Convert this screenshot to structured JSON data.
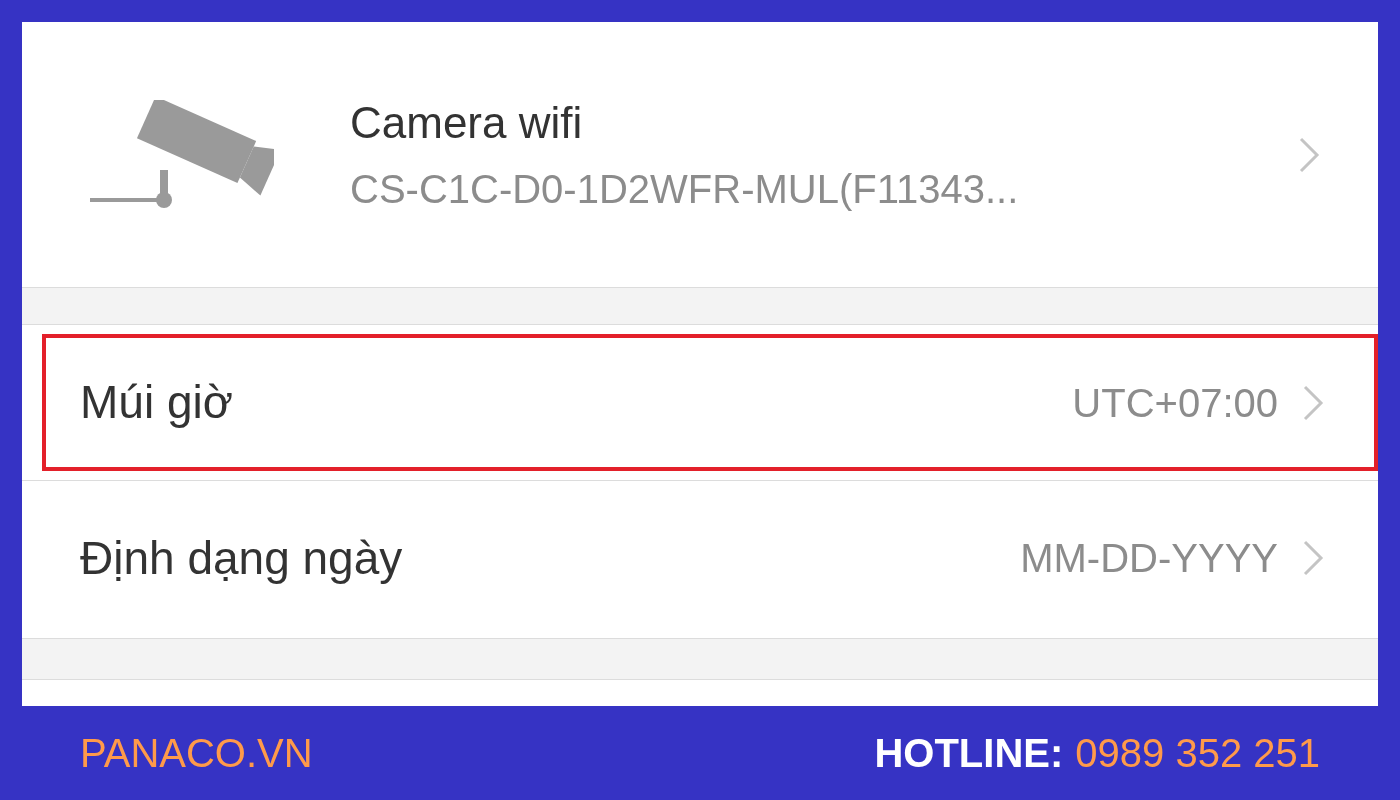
{
  "device": {
    "name": "Camera wifi",
    "model": "CS-C1C-D0-1D2WFR-MUL(F11343..."
  },
  "settings": [
    {
      "label": "Múi giờ",
      "value": "UTC+07:00",
      "highlighted": true
    },
    {
      "label": "Định dạng ngày",
      "value": "MM-DD-YYYY",
      "highlighted": false
    }
  ],
  "banner": {
    "site": "PANACO.VN",
    "hotline_label": "HOTLINE:",
    "hotline": "0989 352 251"
  }
}
